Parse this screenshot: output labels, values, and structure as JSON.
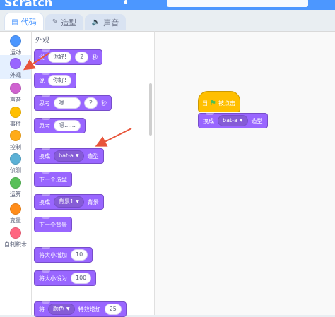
{
  "app": {
    "logo": "Scratch"
  },
  "tabs": [
    {
      "label": "代码",
      "icon": "code-icon"
    },
    {
      "label": "造型",
      "icon": "brush-icon"
    },
    {
      "label": "声音",
      "icon": "speaker-icon"
    }
  ],
  "categories": [
    {
      "label": "运动",
      "color": "#4c97ff"
    },
    {
      "label": "外观",
      "color": "#9966ff"
    },
    {
      "label": "声音",
      "color": "#cf63cf"
    },
    {
      "label": "事件",
      "color": "#ffbf00"
    },
    {
      "label": "控制",
      "color": "#ffab19"
    },
    {
      "label": "侦测",
      "color": "#5cb1d6"
    },
    {
      "label": "运算",
      "color": "#59c059"
    },
    {
      "label": "变量",
      "color": "#ff8c1a"
    },
    {
      "label": "自制积木",
      "color": "#ff6680"
    }
  ],
  "palette": {
    "section_title": "外观",
    "blocks": {
      "say_secs": {
        "prefix": "说",
        "text": "你好!",
        "secs": "2",
        "suffix": "秒"
      },
      "say": {
        "prefix": "说",
        "text": "你好!"
      },
      "think_secs": {
        "prefix": "思考",
        "text": "嗯……",
        "secs": "2",
        "suffix": "秒"
      },
      "think": {
        "prefix": "思考",
        "text": "嗯……"
      },
      "switch_costume": {
        "prefix": "换成",
        "costume": "bat-a",
        "suffix": "造型"
      },
      "next_costume": {
        "label": "下一个造型"
      },
      "switch_backdrop": {
        "prefix": "换成",
        "backdrop": "背景1",
        "suffix": "背景"
      },
      "next_backdrop": {
        "label": "下一个背景"
      },
      "change_size": {
        "prefix": "将大小增加",
        "value": "10"
      },
      "set_size": {
        "prefix": "将大小设为",
        "value": "100"
      },
      "change_effect": {
        "prefix": "将",
        "effect": "颜色",
        "middle": "特效增加",
        "value": "25"
      }
    }
  },
  "workspace": {
    "hat": {
      "prefix": "当",
      "suffix": "被点击"
    },
    "costume_block": {
      "prefix": "换成",
      "costume": "bat-a",
      "suffix": "造型"
    }
  },
  "colors": {
    "looks": "#9966ff",
    "events": "#ffbf00",
    "accent": "#4c97ff",
    "annotation_arrow": "#e8553a"
  }
}
